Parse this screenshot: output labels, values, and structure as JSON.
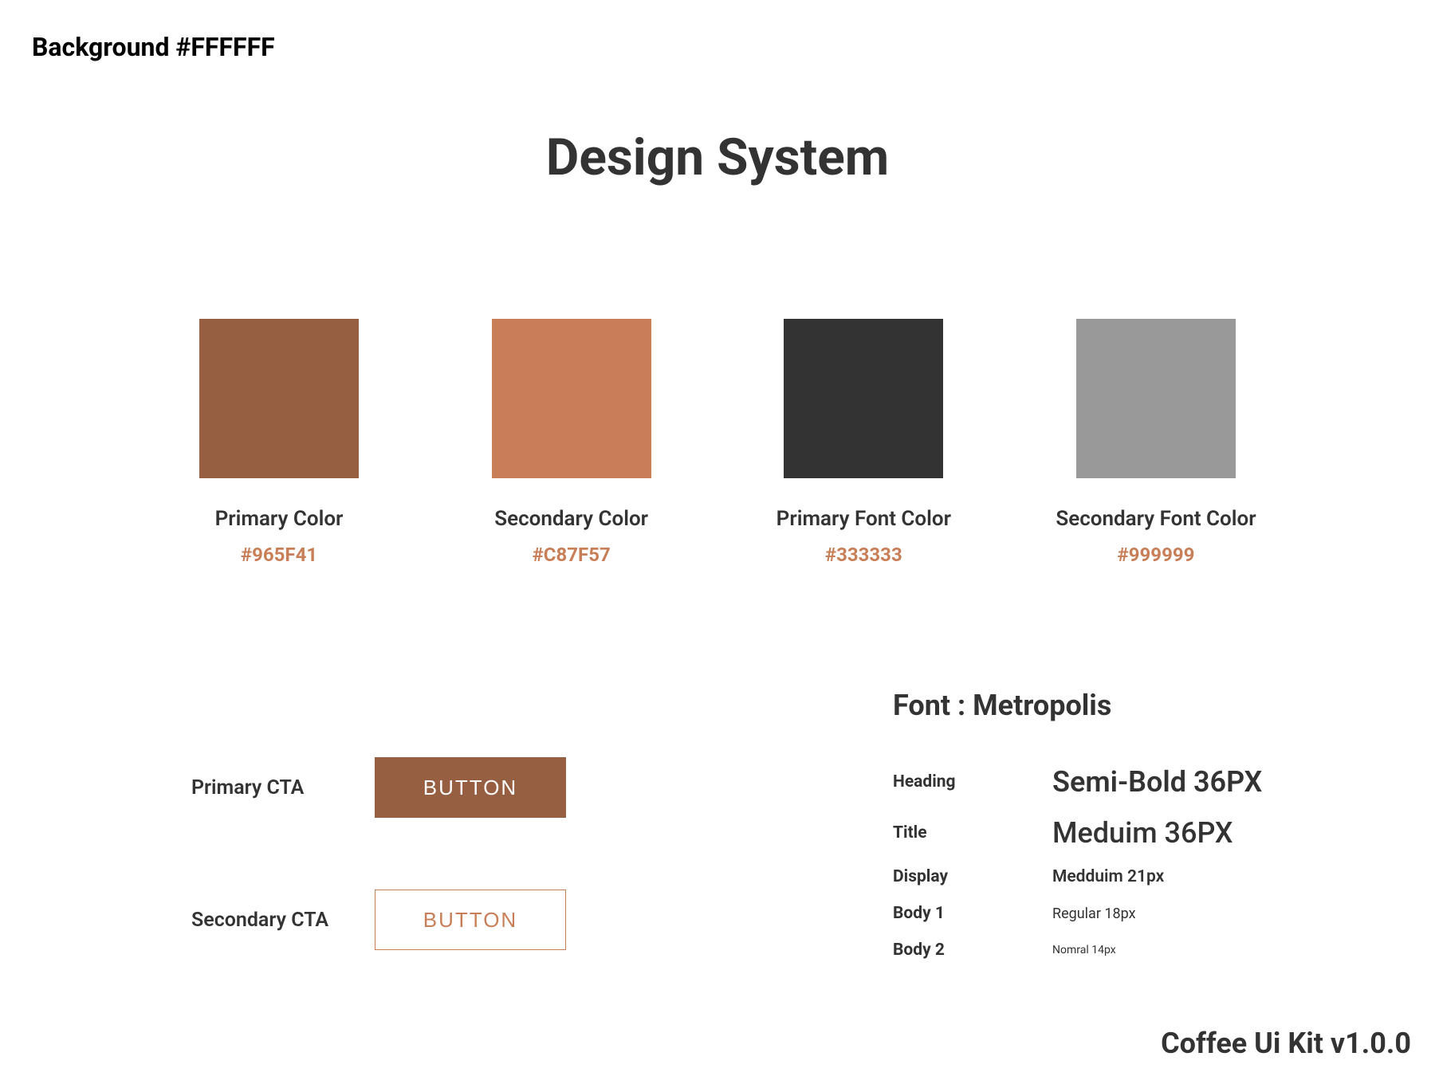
{
  "backgroundLabel": "Background #FFFFFF",
  "pageTitle": "Design System",
  "swatches": [
    {
      "label": "Primary Color",
      "hex": "#965F41",
      "color": "#965F41"
    },
    {
      "label": "Secondary Color",
      "hex": "#C87F57",
      "color": "#C87F57"
    },
    {
      "label": "Primary Font Color",
      "hex": "#333333",
      "color": "#333333"
    },
    {
      "label": "Secondary Font Color",
      "hex": "#999999",
      "color": "#999999"
    }
  ],
  "cta": {
    "primary": {
      "label": "Primary CTA",
      "button": "BUTTON"
    },
    "secondary": {
      "label": "Secondary CTA",
      "button": "BUTTON"
    }
  },
  "typography": {
    "heading": "Font : Metropolis",
    "rows": [
      {
        "key": "Heading",
        "val": "Semi-Bold 36PX",
        "cls": "typo-val-heading"
      },
      {
        "key": "Title",
        "val": "Meduim 36PX",
        "cls": "typo-val-title"
      },
      {
        "key": "Display",
        "val": "Medduim 21px",
        "cls": "typo-val-display"
      },
      {
        "key": "Body 1",
        "val": "Regular 18px",
        "cls": "typo-val-body1"
      },
      {
        "key": "Body 2",
        "val": "Nomral 14px",
        "cls": "typo-val-body2"
      }
    ]
  },
  "footer": "Coffee Ui Kit v1.0.0"
}
